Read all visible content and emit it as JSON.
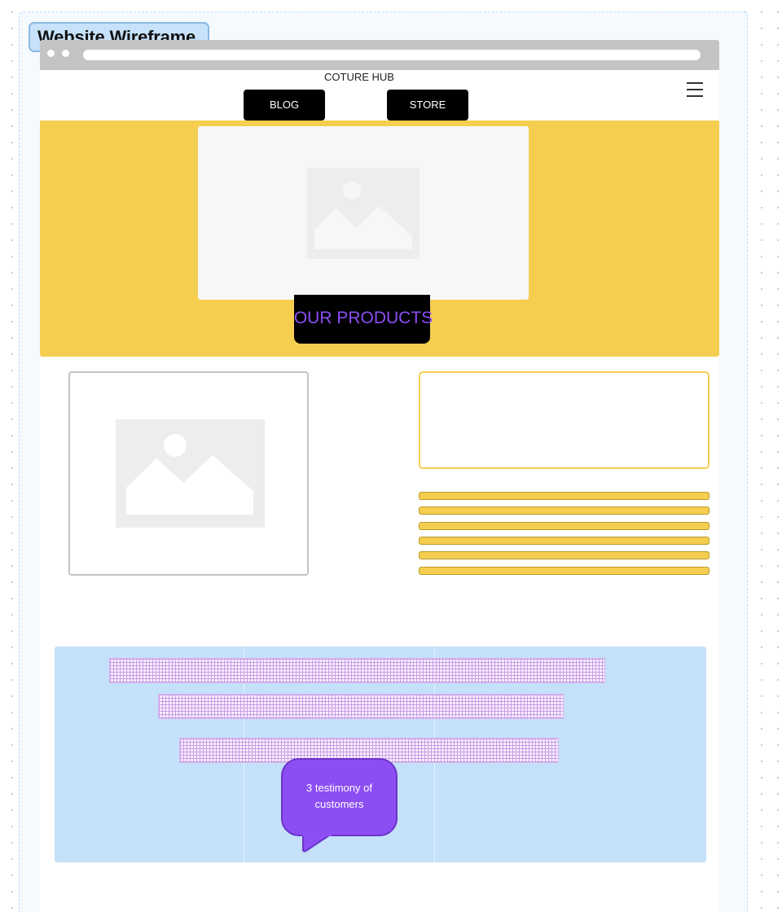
{
  "frame": {
    "title": "Website Wireframe"
  },
  "header": {
    "brand": "COTURE HUB",
    "nav": {
      "blog_label": "BLOG",
      "store_label": "STORE"
    },
    "menu_icon": "hamburger-menu-icon"
  },
  "hero": {
    "image_icon": "image-placeholder-icon",
    "cta_label": "OUR PRODUCTS"
  },
  "content": {
    "image_icon": "image-placeholder-icon",
    "text_line_count": 6
  },
  "testimonials": {
    "note": "3 testimony of customers"
  },
  "colors": {
    "hero_bg": "#f5ce50",
    "button_bg": "#000000",
    "accent_purple": "#8c4ef3",
    "testimonial_bg": "#c5e1fa",
    "frame_title_bg": "#c7e2fa"
  }
}
